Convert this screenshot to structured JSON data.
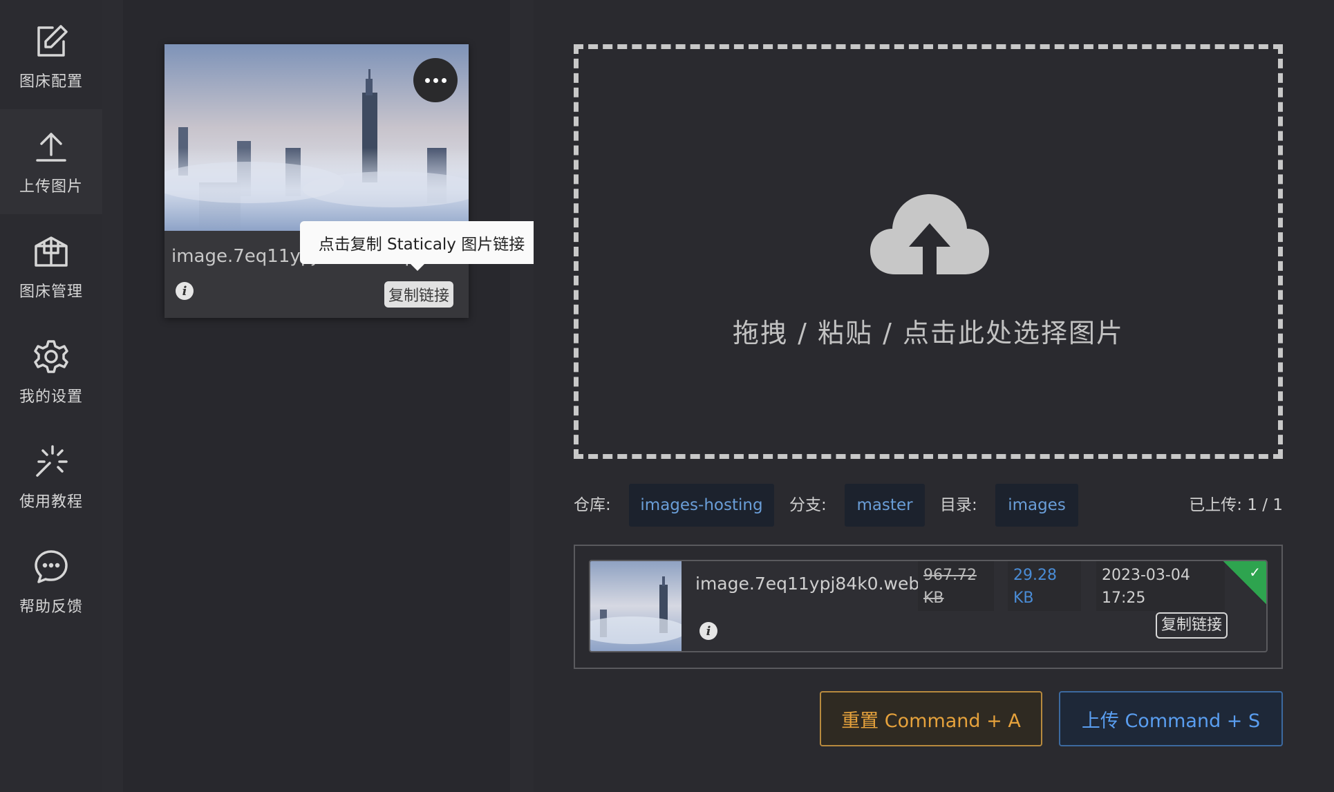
{
  "sidebar": {
    "items": [
      {
        "label": "图床配置",
        "icon": "edit-icon"
      },
      {
        "label": "上传图片",
        "icon": "upload-icon"
      },
      {
        "label": "图床管理",
        "icon": "box-icon"
      },
      {
        "label": "我的设置",
        "icon": "gear-icon"
      },
      {
        "label": "使用教程",
        "icon": "sparkle-icon"
      },
      {
        "label": "帮助反馈",
        "icon": "chat-icon"
      }
    ]
  },
  "card": {
    "name": "image.7eq11ypj84k0.webp",
    "copy_label": "复制链接",
    "tooltip": "点击复制 Staticaly 图片链接"
  },
  "dropzone": {
    "text": "拖拽 / 粘贴 / 点击此处选择图片"
  },
  "repo": {
    "repo_label": "仓库:",
    "repo_value": "images-hosting",
    "branch_label": "分支:",
    "branch_value": "master",
    "dir_label": "目录:",
    "dir_value": "images",
    "uploaded": "已上传: 1 / 1"
  },
  "upload_list": {
    "items": [
      {
        "name": "image.7eq11ypj84k0.web",
        "original_size": "967.72 KB",
        "compressed_size": "29.28 KB",
        "date": "2023-03-04 17:25",
        "copy_label": "复制链接"
      }
    ]
  },
  "actions": {
    "reset": "重置 Command + A",
    "upload": "上传 Command + S"
  },
  "colors": {
    "accent_blue": "#4a8cd6",
    "warning": "#e6a23c",
    "success": "#2ea44f"
  }
}
